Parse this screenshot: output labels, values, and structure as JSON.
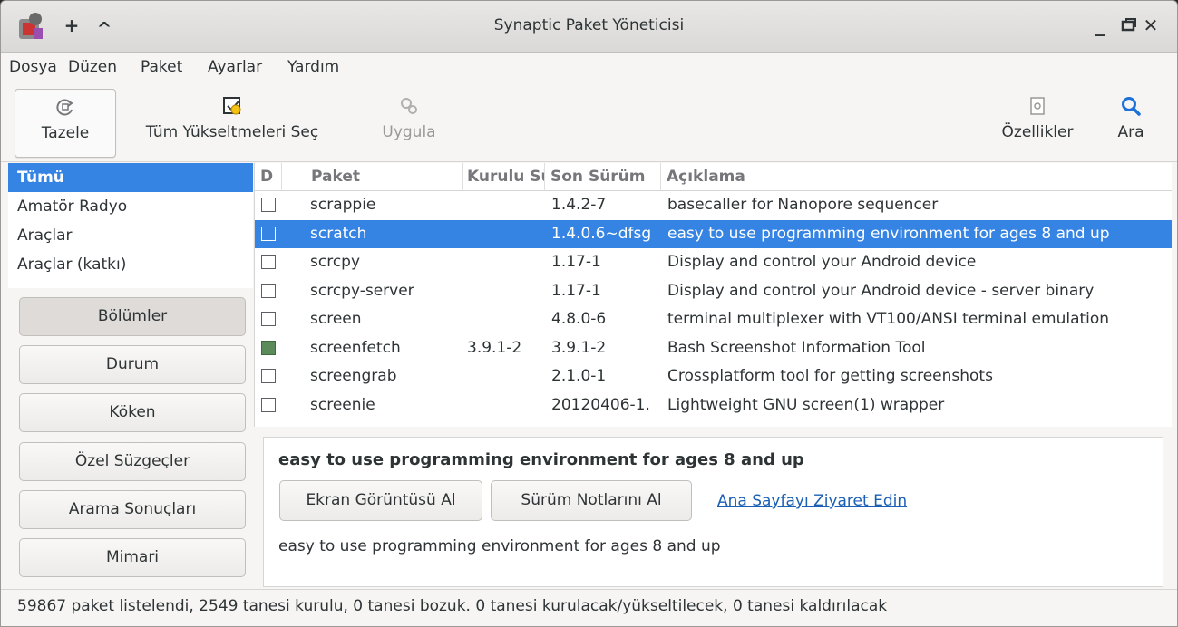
{
  "window": {
    "title": "Synaptic Paket Yöneticisi",
    "add_glyph": "+",
    "up_glyph": "^",
    "minimize_glyph": "_",
    "close_glyph": "✕"
  },
  "menu": [
    "Dosya",
    "Düzen",
    "Paket",
    "Ayarlar",
    "Yardım"
  ],
  "toolbar": {
    "reload": "Tazele",
    "mark_all": "Tüm Yükseltmeleri Seç",
    "apply": "Uygula",
    "properties": "Özellikler",
    "search": "Ara"
  },
  "sidebar": {
    "categories": [
      "Tümü",
      "Amatör Radyo",
      "Araçlar",
      "Araçlar (katkı)"
    ],
    "selected_category": "Tümü",
    "filters": [
      "Bölümler",
      "Durum",
      "Köken",
      "Özel Süzgeçler",
      "Arama Sonuçları",
      "Mimari"
    ],
    "active_filter": "Bölümler"
  },
  "table": {
    "headers": [
      "D",
      "Paket",
      "Kurulu Sü",
      "Son Sürüm",
      "Açıklama"
    ],
    "rows": [
      {
        "name": "scrappie",
        "installed": "",
        "latest": "1.4.2-7",
        "desc": "basecaller for Nanopore sequencer",
        "state": "none"
      },
      {
        "name": "scratch",
        "installed": "",
        "latest": "1.4.0.6~dfsg",
        "desc": "easy to use programming environment for ages 8 and up",
        "state": "none",
        "selected": true
      },
      {
        "name": "scrcpy",
        "installed": "",
        "latest": "1.17-1",
        "desc": "Display and control your Android device",
        "state": "none"
      },
      {
        "name": "scrcpy-server",
        "installed": "",
        "latest": "1.17-1",
        "desc": "Display and control your Android device - server binary",
        "state": "none"
      },
      {
        "name": "screen",
        "installed": "",
        "latest": "4.8.0-6",
        "desc": "terminal multiplexer with VT100/ANSI terminal emulation",
        "state": "none"
      },
      {
        "name": "screenfetch",
        "installed": "3.9.1-2",
        "latest": "3.9.1-2",
        "desc": "Bash Screenshot Information Tool",
        "state": "installed"
      },
      {
        "name": "screengrab",
        "installed": "",
        "latest": "2.1.0-1",
        "desc": "Crossplatform tool for getting screenshots",
        "state": "none"
      },
      {
        "name": "screenie",
        "installed": "",
        "latest": "20120406-1.",
        "desc": "Lightweight GNU screen(1) wrapper",
        "state": "none"
      }
    ]
  },
  "details": {
    "title": "easy to use programming environment for ages 8 and up",
    "screenshot_button": "Ekran Görüntüsü Al",
    "changelog_button": "Sürüm Notlarını Al",
    "homepage_link": "Ana Sayfayı Ziyaret Edin",
    "description": "easy to use programming environment for ages 8 and up"
  },
  "status": "59867 paket listelendi, 2549 tanesi kurulu, 0 tanesi bozuk. 0 tanesi kurulacak/yükseltilecek, 0 tanesi kaldırılacak",
  "colors": {
    "selection": "#3584e4",
    "installed_marker": "#5b8a5b",
    "link": "#1a5fb4"
  }
}
